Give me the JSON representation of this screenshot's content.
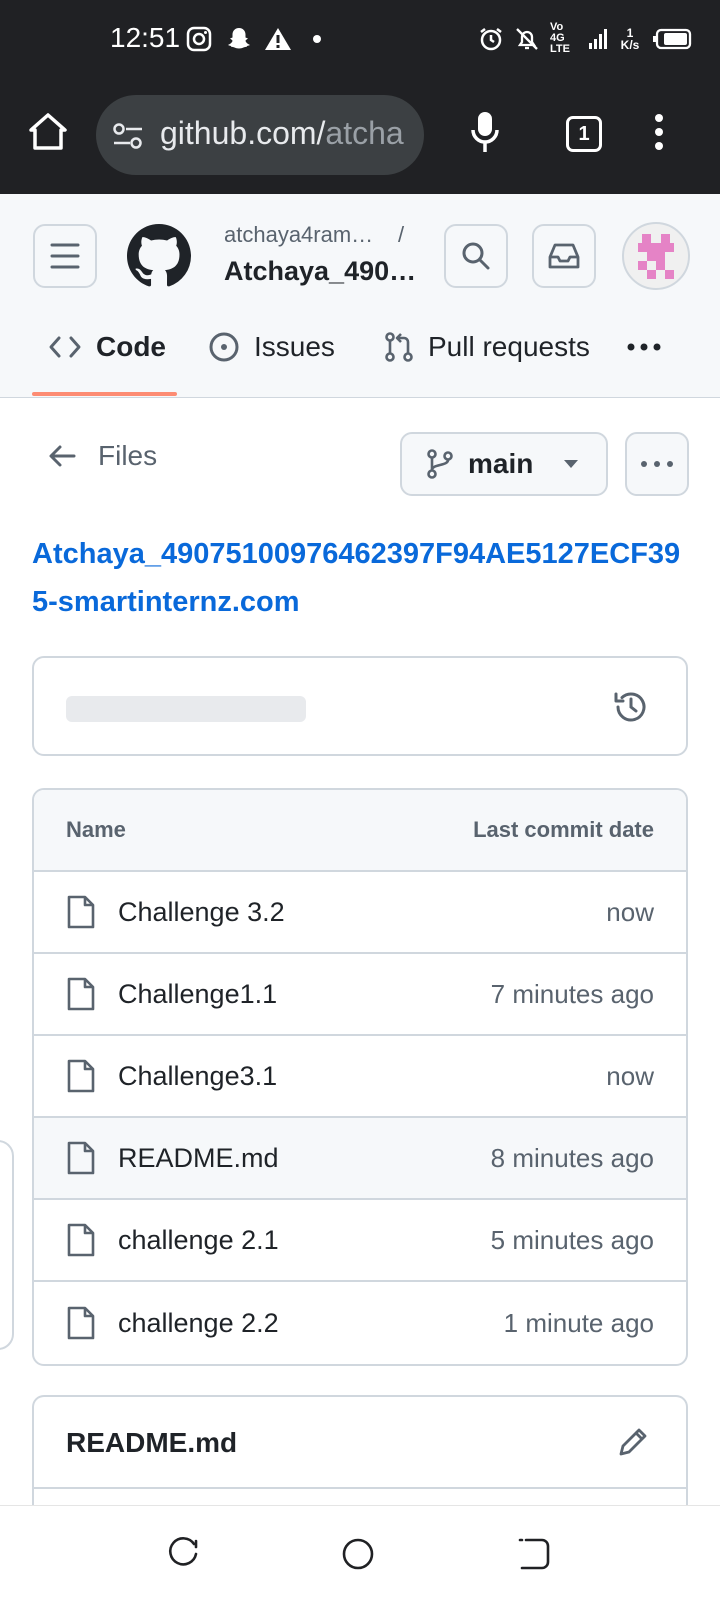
{
  "status_bar": {
    "time": "12:51",
    "network_text": "Vo 4G LTE",
    "speed_value": "1",
    "speed_unit": "K/s"
  },
  "browser": {
    "url_host": "github.com/",
    "url_rest": "atcha",
    "tab_count": "1"
  },
  "repo_header": {
    "owner": "atchaya4ram…",
    "separator": "/",
    "repo_short": "Atchaya_490…"
  },
  "nav_tabs": [
    {
      "label": "Code",
      "active": true
    },
    {
      "label": "Issues",
      "active": false
    },
    {
      "label": "Pull requests",
      "active": false
    }
  ],
  "files_nav": {
    "back_label": "Files",
    "branch": "main"
  },
  "repo_full_name": "Atchaya_49075100976462397F94AE5127ECF395-smartinternz.com",
  "file_table": {
    "col_name": "Name",
    "col_date": "Last commit date",
    "rows": [
      {
        "name": "Challenge 3.2",
        "date": "now"
      },
      {
        "name": "Challenge1.1",
        "date": "7 minutes ago"
      },
      {
        "name": "Challenge3.1",
        "date": "now"
      },
      {
        "name": "README.md",
        "date": "8 minutes ago"
      },
      {
        "name": "challenge 2.1",
        "date": "5 minutes ago"
      },
      {
        "name": "challenge 2.2",
        "date": "1 minute ago"
      }
    ]
  },
  "readme": {
    "title": "README.md"
  },
  "colors": {
    "link": "#0969da",
    "active_underline": "#fd8c73",
    "border": "#d0d7de",
    "muted": "#59636e"
  }
}
